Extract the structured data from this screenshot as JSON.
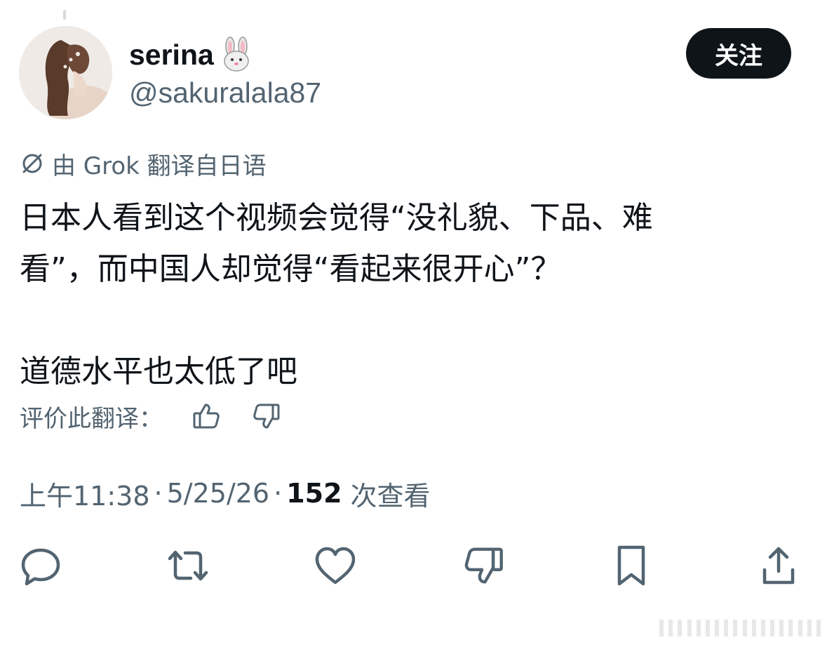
{
  "author": {
    "display_name": "serina",
    "handle": "@sakuralala87",
    "emoji": "rabbit-face-emoji"
  },
  "follow_button": {
    "label": "关注"
  },
  "translation_notice": "由 Grok 翻译自日语",
  "post": {
    "paragraph1_line1": "日本人看到这个视频会觉得“没礼貌、下品、难",
    "paragraph1_line2": "看”，而中国人却觉得“看起来很开心”？",
    "paragraph2": "道德水平也太低了吧"
  },
  "rate_translation": {
    "label": "评价此翻译：",
    "icons": [
      "thumbs-up-icon",
      "thumbs-down-icon"
    ]
  },
  "meta": {
    "time": "上午11:38",
    "date": "5/25/26",
    "views_count": "152",
    "views_label": "次查看",
    "separator": "·"
  },
  "actions": [
    "reply-icon",
    "repost-icon",
    "like-icon",
    "dislike-icon",
    "bookmark-icon",
    "share-icon"
  ],
  "colors": {
    "text_primary": "#0f1419",
    "text_secondary": "#536471",
    "button_bg": "#0f1419"
  }
}
